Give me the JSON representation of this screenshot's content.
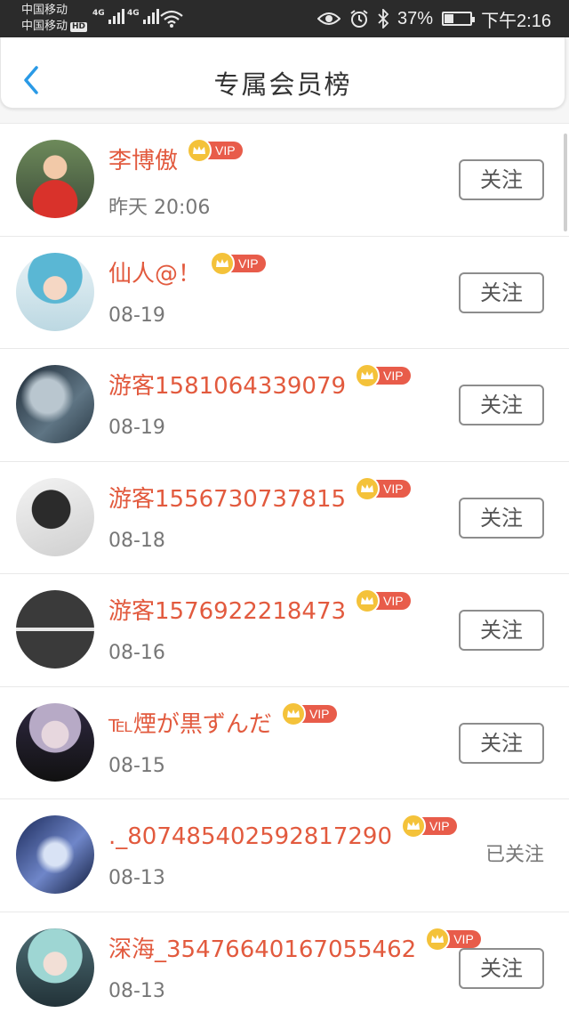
{
  "status_bar": {
    "carrier1": "中国移动",
    "carrier2": "中国移动",
    "hd": "HD",
    "net1": "4G",
    "net2": "4G",
    "battery_pct": "37%",
    "battery_level": 0.37,
    "time": "下午2:16",
    "icons": [
      "eye-icon",
      "alarm-icon",
      "bluetooth-icon",
      "battery-icon",
      "wifi-icon",
      "signal-icon"
    ]
  },
  "header": {
    "title": "专属会员榜",
    "back_icon": "chevron-left-icon"
  },
  "vip_badge": {
    "label": "VIP",
    "icon": "crown-icon"
  },
  "colors": {
    "name": "#e25a3e",
    "vip": "#e85c4a",
    "crown": "#f4c23a",
    "back": "#2a9ae6"
  },
  "members": [
    {
      "name": "李博傲",
      "date": "昨天 20:06",
      "action": "关注",
      "followed": false
    },
    {
      "name": "仙人@！",
      "date": "08-19",
      "action": "关注",
      "followed": false
    },
    {
      "name": "游客1581064339079",
      "date": "08-19",
      "action": "关注",
      "followed": false
    },
    {
      "name": "游客1556730737815",
      "date": "08-18",
      "action": "关注",
      "followed": false
    },
    {
      "name": "游客1576922218473",
      "date": "08-16",
      "action": "关注",
      "followed": false
    },
    {
      "name": "℡煙が黒ずんだ",
      "date": "08-15",
      "action": "关注",
      "followed": false
    },
    {
      "name": "._807485402592817290",
      "date": "08-13",
      "action": "已关注",
      "followed": true
    },
    {
      "name": "深海_35476640167055462",
      "date": "08-13",
      "action": "关注",
      "followed": false
    }
  ]
}
